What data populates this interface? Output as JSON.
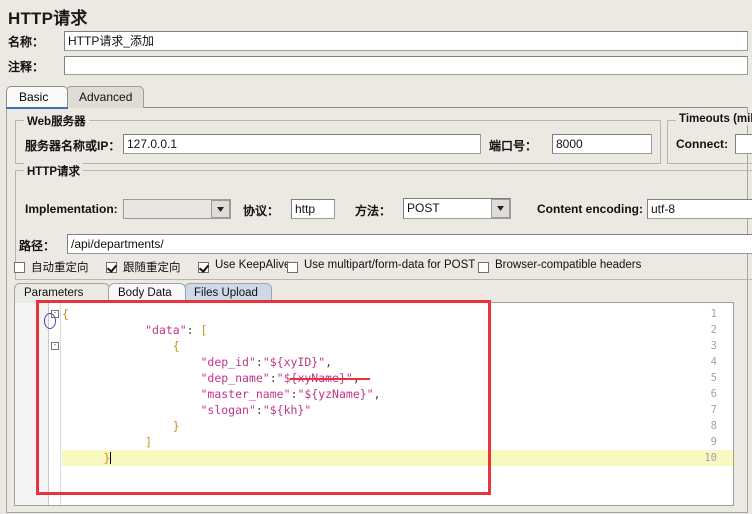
{
  "window": {
    "title": "HTTP请求"
  },
  "form": {
    "name_label": "名称：",
    "name_value": "HTTP请求_添加",
    "comment_label": "注释：",
    "comment_value": ""
  },
  "tabs": {
    "basic": "Basic",
    "advanced": "Advanced",
    "selected": "Basic"
  },
  "web_server": {
    "group_title": "Web服务器",
    "server_label": "服务器名称或IP：",
    "server_value": "127.0.0.1",
    "port_label": "端口号：",
    "port_value": "8000"
  },
  "timeouts": {
    "group_title": "Timeouts (milli",
    "connect_label": "Connect:",
    "connect_value": "",
    "response_label": "",
    "response_value": ""
  },
  "http_request": {
    "group_title": "HTTP请求",
    "implementation_label": "Implementation:",
    "implementation_value": "",
    "protocol_label": "协议：",
    "protocol_value": "http",
    "method_label": "方法：",
    "method_value": "POST",
    "encoding_label": "Content encoding:",
    "encoding_value": "utf-8",
    "path_label": "路径：",
    "path_value": "/api/departments/"
  },
  "checkboxes": [
    {
      "label": "自动重定向",
      "checked": false
    },
    {
      "label": "跟随重定向",
      "checked": true
    },
    {
      "label": "Use KeepAlive",
      "checked": true
    },
    {
      "label": "Use multipart/form-data for POST",
      "checked": false
    },
    {
      "label": "Browser-compatible headers",
      "checked": false
    }
  ],
  "inner_tabs": {
    "parameters": "Parameters",
    "body_data": "Body Data",
    "files_upload": "Files Upload",
    "selected": "Body Data"
  },
  "body_editor": {
    "line_numbers": [
      "1",
      "2",
      "3",
      "4",
      "5",
      "6",
      "7",
      "8",
      "9",
      "10"
    ],
    "highlighted_line": 10,
    "cursor_line": 10,
    "lines": [
      "{",
      "            \"data\": [",
      "                {",
      "                    \"dep_id\":\"${xyID}\",",
      "                    \"dep_name\":\"${xyName}\",",
      "                    \"master_name\":\"${yzName}\",",
      "                    \"slogan\":\"${kh}\"",
      "                }",
      "            ]",
      "      }"
    ],
    "fold_lines": [
      1,
      3
    ]
  },
  "annotations": {
    "rect_color": "#e8323c",
    "underline_color": "#e8323c",
    "oval_color": "#5b3fa8",
    "underline_target": "\"${xyID}\"",
    "oval_target": "{"
  },
  "colors": {
    "bg": "#ece9e3",
    "field_bg": "#ffffff",
    "key": "#c0348a",
    "punct": "#cf8d1a",
    "highlight": "#fbf7c0",
    "tab_selected_underline": "#3f6fb5"
  }
}
